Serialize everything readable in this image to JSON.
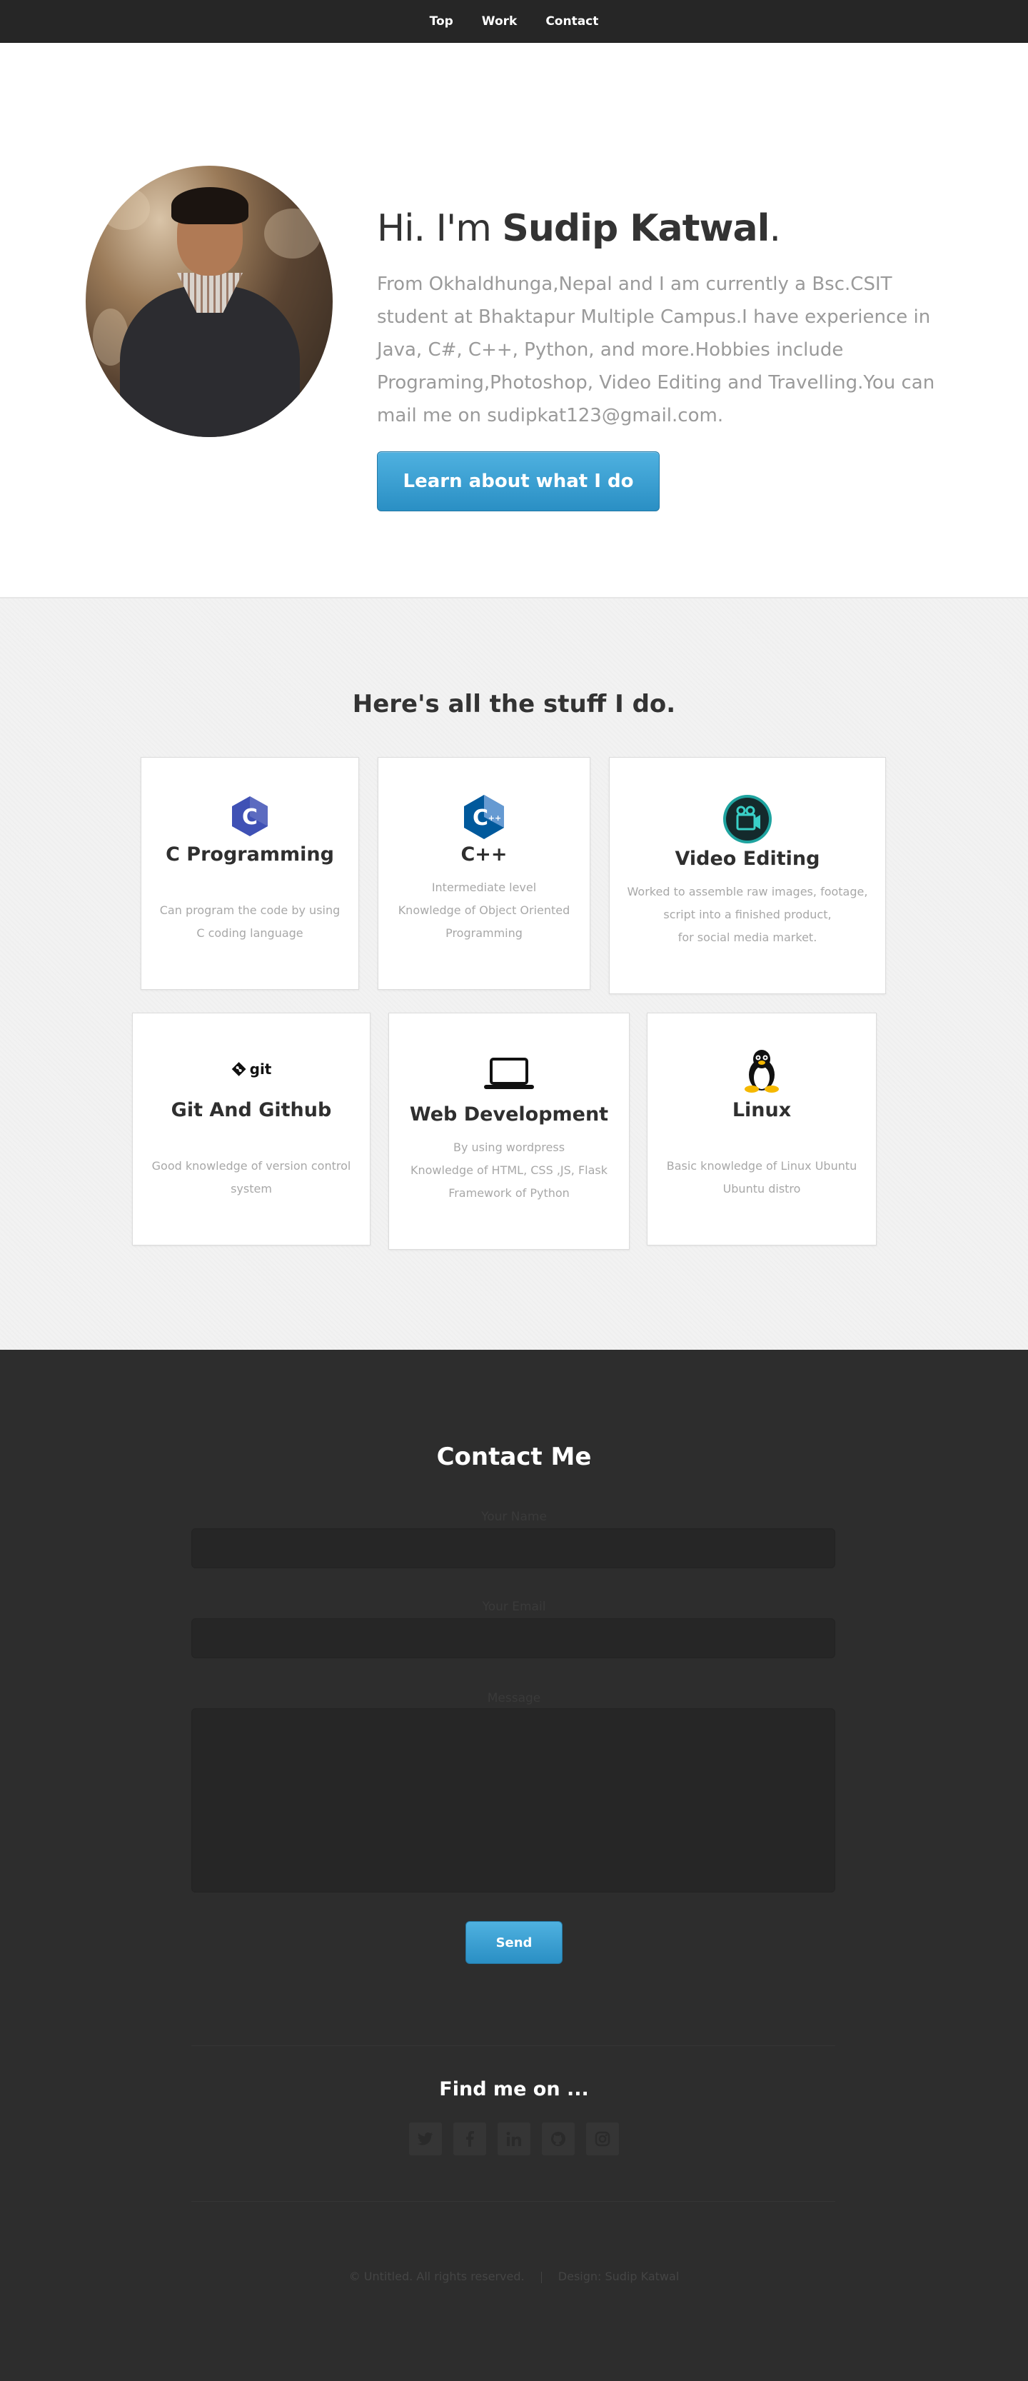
{
  "nav": {
    "items": [
      "Top",
      "Work",
      "Contact"
    ]
  },
  "hero": {
    "greeting": "Hi. I'm ",
    "name": "Sudip Katwal",
    "period": ".",
    "description": "From Okhaldhunga,Nepal and I am currently a Bsc.CSIT student at Bhaktapur Multiple Campus.I have experience in Java, C#, C++, Python, and more.Hobbies include Programing,Photoshop, Video Editing and Travelling.You can mail me on sudipkat123@gmail.com.",
    "button": "Learn about what I do"
  },
  "work": {
    "title": "Here's all the stuff I do.",
    "cards": [
      {
        "title": "C Programming",
        "icon": "c-language-icon",
        "lines": [
          "Can program the code by using",
          "C coding language"
        ]
      },
      {
        "title": "C++",
        "icon": "cpp-language-icon",
        "lines": [
          "Intermediate level",
          "Knowledge of Object Oriented",
          "Programming"
        ]
      },
      {
        "title": "Video Editing",
        "icon": "video-camera-icon",
        "lines": [
          "Worked to assemble raw images, footage,",
          "script into a finished product,",
          "for social media market."
        ]
      },
      {
        "title": "Git And Github",
        "icon": "git-logo-icon",
        "icon_text": "git",
        "lines": [
          "Good knowledge of version control",
          "system"
        ]
      },
      {
        "title": "Web Development",
        "icon": "laptop-icon",
        "lines": [
          "By using wordpress",
          "Knowledge of HTML, CSS ,JS, Flask",
          "Framework of Python"
        ]
      },
      {
        "title": "Linux",
        "icon": "linux-penguin-icon",
        "lines": [
          "Basic knowledge of Linux Ubuntu",
          "Ubuntu distro"
        ]
      }
    ]
  },
  "contact": {
    "title": "Contact Me",
    "name_label": "Your Name",
    "email_label": "Your Email",
    "message_label": "Message",
    "send": "Send",
    "find_title": "Find me on ...",
    "socials": [
      "twitter-icon",
      "facebook-icon",
      "linkedin-icon",
      "github-icon",
      "instagram-icon"
    ],
    "footer_left": "© Untitled. All rights reserved.",
    "footer_right": "Design: Sudip Katwal"
  }
}
